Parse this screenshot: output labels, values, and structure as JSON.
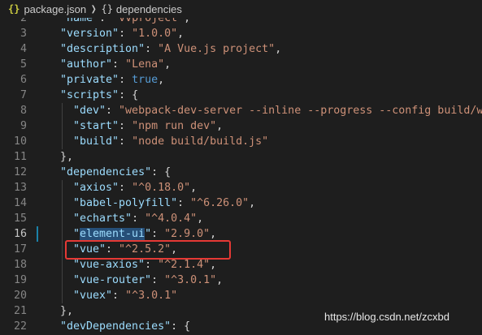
{
  "breadcrumb": {
    "file_icon": "{}",
    "file_name": "package.json",
    "separator_icon": "chevron-right-icon",
    "symbol_icon": "{}",
    "symbol_name": "dependencies"
  },
  "editor": {
    "current_line": 16,
    "modified_line_color": "#1b81a8",
    "selection_color": "#264f78",
    "lines": [
      {
        "num": "2",
        "tokens": [
          {
            "t": "\"name\"",
            "c": "key"
          },
          {
            "t": ": ",
            "c": "punct"
          },
          {
            "t": "\"vvproject\"",
            "c": "str"
          },
          {
            "t": ",",
            "c": "punct"
          }
        ]
      },
      {
        "num": "3",
        "tokens": [
          {
            "t": "\"version\"",
            "c": "key"
          },
          {
            "t": ": ",
            "c": "punct"
          },
          {
            "t": "\"1.0.0\"",
            "c": "str"
          },
          {
            "t": ",",
            "c": "punct"
          }
        ]
      },
      {
        "num": "4",
        "tokens": [
          {
            "t": "\"description\"",
            "c": "key"
          },
          {
            "t": ": ",
            "c": "punct"
          },
          {
            "t": "\"A Vue.js project\"",
            "c": "str"
          },
          {
            "t": ",",
            "c": "punct"
          }
        ]
      },
      {
        "num": "5",
        "tokens": [
          {
            "t": "\"author\"",
            "c": "key"
          },
          {
            "t": ": ",
            "c": "punct"
          },
          {
            "t": "\"Lena\"",
            "c": "str"
          },
          {
            "t": ",",
            "c": "punct"
          }
        ]
      },
      {
        "num": "6",
        "tokens": [
          {
            "t": "\"private\"",
            "c": "key"
          },
          {
            "t": ": ",
            "c": "punct"
          },
          {
            "t": "true",
            "c": "bool"
          },
          {
            "t": ",",
            "c": "punct"
          }
        ]
      },
      {
        "num": "7",
        "tokens": [
          {
            "t": "\"scripts\"",
            "c": "key"
          },
          {
            "t": ": {",
            "c": "punct"
          }
        ]
      },
      {
        "num": "8",
        "indent": 1,
        "tokens": [
          {
            "t": "\"dev\"",
            "c": "key"
          },
          {
            "t": ": ",
            "c": "punct"
          },
          {
            "t": "\"webpack-dev-server --inline --progress --config build/webpack.dev.conf.js\"",
            "c": "str"
          },
          {
            "t": ",",
            "c": "punct"
          }
        ]
      },
      {
        "num": "9",
        "indent": 1,
        "tokens": [
          {
            "t": "\"start\"",
            "c": "key"
          },
          {
            "t": ": ",
            "c": "punct"
          },
          {
            "t": "\"npm run dev\"",
            "c": "str"
          },
          {
            "t": ",",
            "c": "punct"
          }
        ]
      },
      {
        "num": "10",
        "indent": 1,
        "tokens": [
          {
            "t": "\"build\"",
            "c": "key"
          },
          {
            "t": ": ",
            "c": "punct"
          },
          {
            "t": "\"node build/build.js\"",
            "c": "str"
          }
        ]
      },
      {
        "num": "11",
        "tokens": [
          {
            "t": "},",
            "c": "punct"
          }
        ]
      },
      {
        "num": "12",
        "tokens": [
          {
            "t": "\"dependencies\"",
            "c": "key"
          },
          {
            "t": ": {",
            "c": "punct"
          }
        ]
      },
      {
        "num": "13",
        "indent": 1,
        "tokens": [
          {
            "t": "\"axios\"",
            "c": "key"
          },
          {
            "t": ": ",
            "c": "punct"
          },
          {
            "t": "\"^0.18.0\"",
            "c": "str"
          },
          {
            "t": ",",
            "c": "punct"
          }
        ]
      },
      {
        "num": "14",
        "indent": 1,
        "tokens": [
          {
            "t": "\"babel-polyfill\"",
            "c": "key"
          },
          {
            "t": ": ",
            "c": "punct"
          },
          {
            "t": "\"^6.26.0\"",
            "c": "str"
          },
          {
            "t": ",",
            "c": "punct"
          }
        ]
      },
      {
        "num": "15",
        "indent": 1,
        "tokens": [
          {
            "t": "\"echarts\"",
            "c": "key"
          },
          {
            "t": ": ",
            "c": "punct"
          },
          {
            "t": "\"^4.0.4\"",
            "c": "str"
          },
          {
            "t": ",",
            "c": "punct"
          }
        ]
      },
      {
        "num": "16",
        "indent": 1,
        "current": true,
        "modified": true,
        "tokens": [
          {
            "t": "\"",
            "c": "key"
          },
          {
            "t": "element-ui",
            "c": "sel"
          },
          {
            "t": "\"",
            "c": "key"
          },
          {
            "t": ": ",
            "c": "punct"
          },
          {
            "t": "\"2.9.0\"",
            "c": "str"
          },
          {
            "t": ",",
            "c": "punct"
          }
        ]
      },
      {
        "num": "17",
        "indent": 1,
        "tokens": [
          {
            "t": "\"vue\"",
            "c": "key"
          },
          {
            "t": ": ",
            "c": "punct"
          },
          {
            "t": "\"^2.5.2\"",
            "c": "str"
          },
          {
            "t": ",",
            "c": "punct"
          }
        ]
      },
      {
        "num": "18",
        "indent": 1,
        "tokens": [
          {
            "t": "\"vue-axios\"",
            "c": "key"
          },
          {
            "t": ": ",
            "c": "punct"
          },
          {
            "t": "\"^2.1.4\"",
            "c": "str"
          },
          {
            "t": ",",
            "c": "punct"
          }
        ]
      },
      {
        "num": "19",
        "indent": 1,
        "tokens": [
          {
            "t": "\"vue-router\"",
            "c": "key"
          },
          {
            "t": ": ",
            "c": "punct"
          },
          {
            "t": "\"^3.0.1\"",
            "c": "str"
          },
          {
            "t": ",",
            "c": "punct"
          }
        ]
      },
      {
        "num": "20",
        "indent": 1,
        "tokens": [
          {
            "t": "\"vuex\"",
            "c": "key"
          },
          {
            "t": ": ",
            "c": "punct"
          },
          {
            "t": "\"^3.0.1\"",
            "c": "str"
          }
        ]
      },
      {
        "num": "21",
        "tokens": [
          {
            "t": "},",
            "c": "punct"
          }
        ]
      },
      {
        "num": "22",
        "tokens": [
          {
            "t": "\"devDependencies\"",
            "c": "key"
          },
          {
            "t": ": {",
            "c": "punct"
          }
        ]
      }
    ]
  },
  "annotation": {
    "box_color": "#e53935"
  },
  "watermark": "https://blog.csdn.net/zcxbd"
}
